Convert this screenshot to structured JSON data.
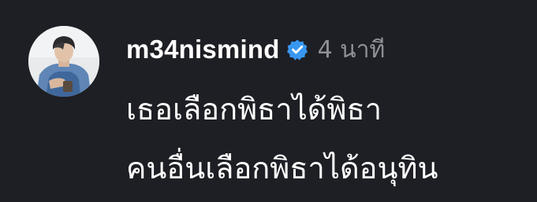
{
  "comment": {
    "username": "m34nismind",
    "verified_icon": "verified-badge-icon",
    "verified_color": "#3897f0",
    "timestamp": "4 นาที",
    "lines": [
      "เธอเลือกพิธาได้พิธา",
      "คนอื่นเลือกพิธาได้อนุทิน"
    ]
  },
  "avatar": {
    "icon": "profile-photo"
  }
}
